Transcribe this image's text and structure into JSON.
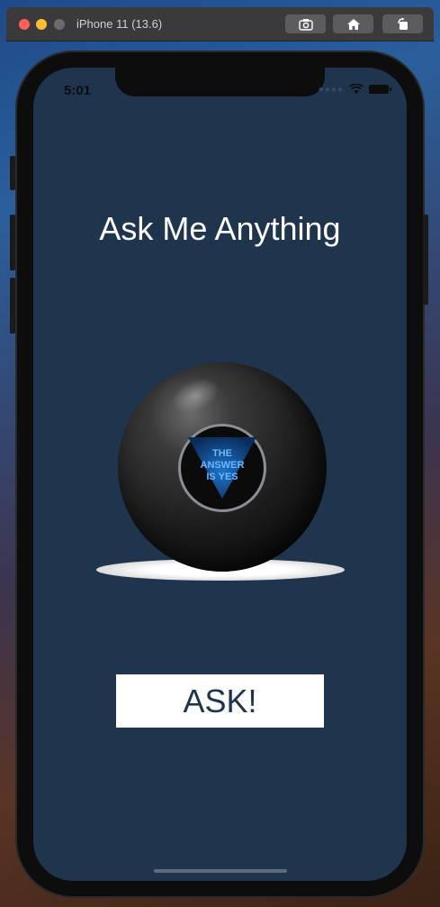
{
  "window": {
    "title": "iPhone 11 (13.6)",
    "buttons": [
      {
        "icon": "screenshot-camera-icon"
      },
      {
        "icon": "home-icon"
      },
      {
        "icon": "rotate-icon"
      }
    ]
  },
  "status_bar": {
    "time": "5:01",
    "icons": [
      "cellular-signal-icon",
      "wifi-icon",
      "battery-icon"
    ]
  },
  "app": {
    "title": "Ask Me Anything",
    "ball_answer_line1": "THE",
    "ball_answer_line2": "ANSWER",
    "ball_answer_line3": "IS YES",
    "ask_button_label": "ASK!"
  },
  "colors": {
    "background": "#1f344d",
    "title_text": "#ffffff",
    "button_bg": "#ffffff",
    "button_text": "#1f344d",
    "answer_text": "#6ab8ff"
  }
}
